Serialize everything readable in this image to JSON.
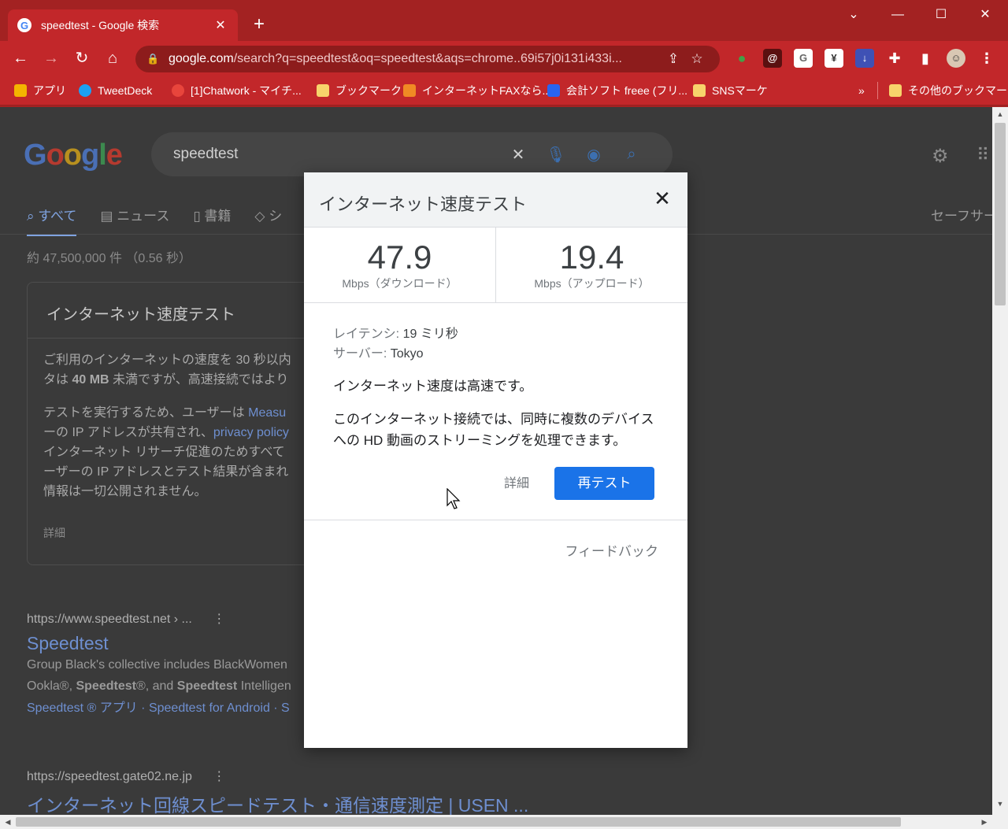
{
  "browser": {
    "tab": {
      "title": "speedtest - Google 検索",
      "close": "✕"
    },
    "new_tab": "+",
    "window_controls": {
      "tabsearch": "⌄",
      "minimize": "—",
      "maximize": "☐",
      "close": "✕"
    },
    "nav": {
      "back": "←",
      "forward": "→",
      "reload": "↻",
      "home": "⌂"
    },
    "url_host": "google.com",
    "url_rest": "/search?q=speedtest&oq=speedtest&aqs=chrome..69i57j0i131i433i...",
    "extensions": [
      "G",
      "¥"
    ],
    "bookmarks": [
      {
        "label": "アプリ",
        "color": "#f4b400"
      },
      {
        "label": "TweetDeck",
        "color": "#1da1f2"
      },
      {
        "label": "[1]Chatwork - マイチ...",
        "color": "#e8453c"
      },
      {
        "label": "ブックマーク",
        "color": "#f7d36b"
      },
      {
        "label": "インターネットFAXなら...",
        "color": "#f08a24"
      },
      {
        "label": "会計ソフト freee (フリ...",
        "color": "#2864f0"
      },
      {
        "label": "SNSマーケ",
        "color": "#f7d36b"
      }
    ],
    "bookmarks_more": "»",
    "other_bookmarks": "その他のブックマーク"
  },
  "search": {
    "logo": "Google",
    "query": "speedtest",
    "tabs": [
      "すべて",
      "ニュース",
      "書籍",
      "シ"
    ],
    "safesearch": "セーフサー",
    "result_stats": "約 47,500,000 件 （0.56 秒）",
    "card": {
      "title": "インターネット速度テスト",
      "p1_a": "ご利用のインターネットの速度を 30 秒以内",
      "p1_b_pre": "タは ",
      "p1_b_bold": "40 MB",
      "p1_b_post": " 未満ですが、高速接続ではより",
      "p2_a": "テストを実行するため、ユーザーは ",
      "p2_a_link": "Measu",
      "p2_b": "ーの IP アドレスが共有され、",
      "p2_b_link": "privacy policy",
      "p2_c": "インターネット リサーチ促進のためすべて",
      "p2_d": "ーザーの IP アドレスとテスト結果が含まれ",
      "p2_e": "情報は一切公開されません。",
      "detail": "詳細"
    },
    "results": [
      {
        "url": "https://www.speedtest.net › ...",
        "title": "Speedtest",
        "desc1": "Group Black's collective includes BlackWomen",
        "desc2_pre": "Ookla®, ",
        "desc2_b1": "Speedtest",
        "desc2_mid": "®, and ",
        "desc2_b2": "Speedtest",
        "desc2_post": " Intelligen",
        "links": "Speedtest ® アプリ · Speedtest for Android · S"
      },
      {
        "url": "https://speedtest.gate02.ne.jp",
        "title": "インターネット回線スピードテスト・通信速度測定 | USEN ..."
      }
    ]
  },
  "dialog": {
    "title": "インターネット速度テスト",
    "download": {
      "value": "47.9",
      "unit": "Mbps（ダウンロード）"
    },
    "upload": {
      "value": "19.4",
      "unit": "Mbps（アップロード）"
    },
    "latency_label": "レイテンシ: ",
    "latency_value": "19 ミリ秒",
    "server_label": "サーバー: ",
    "server_value": "Tokyo",
    "speed_summary": "インターネット速度は高速です。",
    "capability": "このインターネット接続では、同時に複数のデバイスへの HD 動画のストリーミングを処理できます。",
    "detail_button": "詳細",
    "retest_button": "再テスト",
    "feedback": "フィードバック"
  },
  "colors": {
    "frame": "#a32222",
    "tab": "#c2272a",
    "primary": "#1a73e8"
  }
}
